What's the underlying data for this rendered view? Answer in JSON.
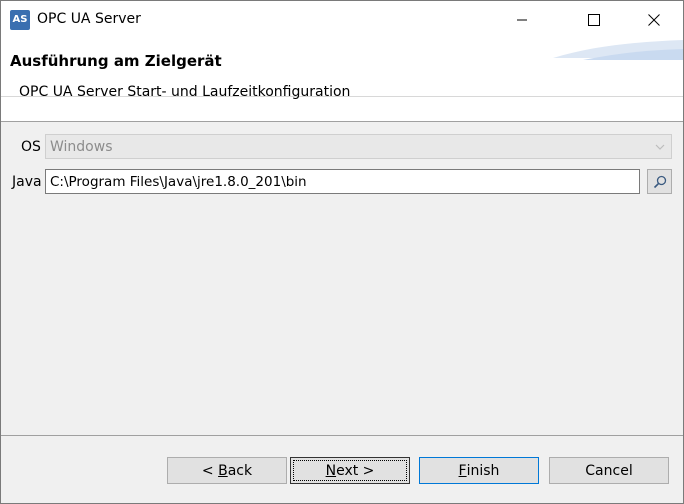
{
  "window": {
    "title": "OPC UA Server",
    "app_icon": "AS"
  },
  "titlebar": {
    "minimize_icon": "minimize-icon",
    "maximize_icon": "maximize-icon",
    "close_icon": "close-icon"
  },
  "header": {
    "title": "Ausführung am Zielgerät",
    "subtitle": "OPC UA Server Start- und Laufzeitkonfiguration"
  },
  "form": {
    "os": {
      "label": "OS",
      "value": "Windows"
    },
    "java": {
      "label": "Java",
      "value": "C:\\Program Files\\Java\\jre1.8.0_201\\bin",
      "browse_icon": "search-icon"
    }
  },
  "buttons": {
    "back": {
      "prefix": "< ",
      "mnemonic": "B",
      "rest": "ack"
    },
    "next": {
      "mnemonic": "N",
      "rest": "ext >"
    },
    "finish": {
      "mnemonic": "F",
      "rest": "inish"
    },
    "cancel": {
      "label": "Cancel"
    }
  },
  "colors": {
    "accent": "#0078d7",
    "header_bg": "#ffffff",
    "body_bg": "#f0f0f0"
  }
}
